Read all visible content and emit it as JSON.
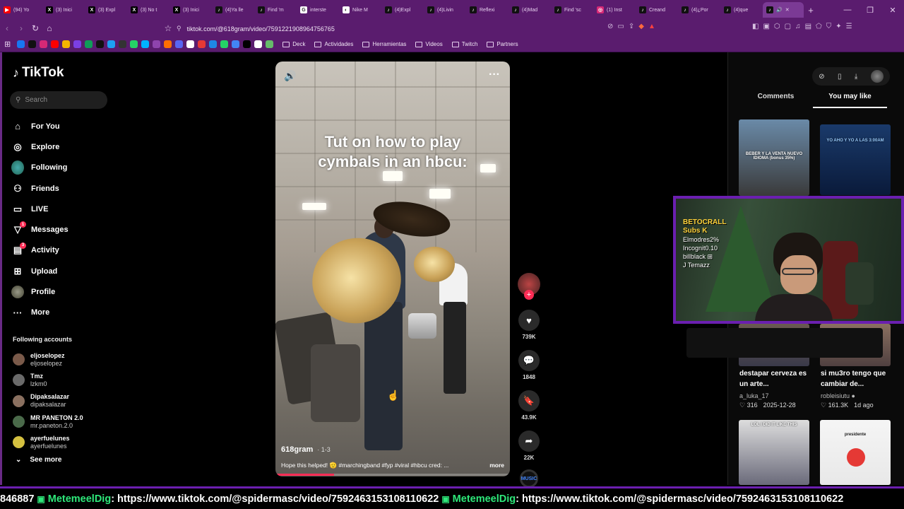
{
  "browser": {
    "tabs": [
      {
        "label": "(94) Yo",
        "icon": "youtube-icon",
        "color": "#ff0000",
        "glyph": "▶"
      },
      {
        "label": "(3) Inici",
        "icon": "x-icon",
        "color": "#000000",
        "glyph": "X"
      },
      {
        "label": "(3) Expl",
        "icon": "x-icon",
        "color": "#000000",
        "glyph": "X"
      },
      {
        "label": "(3) No t",
        "icon": "x-icon",
        "color": "#000000",
        "glyph": "X"
      },
      {
        "label": "(3) Inici",
        "icon": "x-icon",
        "color": "#000000",
        "glyph": "X"
      },
      {
        "label": "(4)Ya lle",
        "icon": "tiktok-icon",
        "color": "#111111",
        "glyph": "♪"
      },
      {
        "label": "Find 'm",
        "icon": "tiktok-icon",
        "color": "#111111",
        "glyph": "♪"
      },
      {
        "label": "interste",
        "icon": "google-icon",
        "color": "#ffffff",
        "glyph": "G"
      },
      {
        "label": "Nike M",
        "icon": "site-icon",
        "color": "#ffffff",
        "glyph": "◐"
      },
      {
        "label": "(4)Expl",
        "icon": "tiktok-icon",
        "color": "#111111",
        "glyph": "♪"
      },
      {
        "label": "(4)Livin",
        "icon": "tiktok-icon",
        "color": "#111111",
        "glyph": "♪"
      },
      {
        "label": "Reflexi",
        "icon": "tiktok-icon",
        "color": "#111111",
        "glyph": "♪"
      },
      {
        "label": "(4)Mad",
        "icon": "tiktok-icon",
        "color": "#111111",
        "glyph": "♪"
      },
      {
        "label": "Find 'sc",
        "icon": "tiktok-icon",
        "color": "#111111",
        "glyph": "♪"
      },
      {
        "label": "(1) Inst",
        "icon": "instagram-icon",
        "color": "#d62976",
        "glyph": "◎"
      },
      {
        "label": "Creand",
        "icon": "tiktok-icon",
        "color": "#111111",
        "glyph": "♪"
      },
      {
        "label": "(4)¿Por",
        "icon": "tiktok-icon",
        "color": "#111111",
        "glyph": "♪"
      },
      {
        "label": "(4)que",
        "icon": "tiktok-icon",
        "color": "#111111",
        "glyph": "♪"
      }
    ],
    "active_tab_glyph": "♪",
    "active_tab_audio": "🔊",
    "active_tab_close": "✕",
    "new_tab": "+",
    "window_controls": {
      "minimize": "—",
      "maximize": "❐",
      "close": "✕"
    },
    "url": "tiktok.com/@618gram/video/7591221908964756765",
    "bookmarks": [
      {
        "label": "Deck"
      },
      {
        "label": "Actividades"
      },
      {
        "label": "Herramientas"
      },
      {
        "label": "Videos"
      },
      {
        "label": "Twitch"
      },
      {
        "label": "Partners"
      }
    ],
    "bookmark_icon_colors": [
      "#1877f2",
      "#111111",
      "#d62976",
      "#ff0000",
      "#f4b400",
      "#7b3fe4",
      "#0f9d58",
      "#111111",
      "#1da1f2",
      "#333333",
      "#25d366",
      "#00b2ff",
      "#8e44ad",
      "#ff6f00",
      "#5865f2",
      "#ffffff",
      "#e53935",
      "#1e88e5",
      "#25d366",
      "#4285f4",
      "#000000",
      "#ffffff",
      "#66bb6a"
    ]
  },
  "tiktok": {
    "logo": "TikTok",
    "search_placeholder": "Search",
    "nav": [
      {
        "label": "For You",
        "icon": "home-icon",
        "glyph": "⌂"
      },
      {
        "label": "Explore",
        "icon": "compass-icon",
        "glyph": "◎"
      },
      {
        "label": "Following",
        "icon": "following-avatar-icon",
        "glyph": ""
      },
      {
        "label": "Friends",
        "icon": "friends-icon",
        "glyph": "⚇"
      },
      {
        "label": "LIVE",
        "icon": "live-icon",
        "glyph": "▭"
      },
      {
        "label": "Messages",
        "icon": "messages-icon",
        "glyph": "▽",
        "badge": "1"
      },
      {
        "label": "Activity",
        "icon": "activity-icon",
        "glyph": "▤",
        "badge": "3"
      },
      {
        "label": "Upload",
        "icon": "upload-icon",
        "glyph": "⊞"
      },
      {
        "label": "Profile",
        "icon": "profile-avatar-icon",
        "glyph": ""
      },
      {
        "label": "More",
        "icon": "more-icon",
        "glyph": "···"
      }
    ],
    "following_header": "Following accounts",
    "following": [
      {
        "name": "eljoselopez",
        "handle": "eljoselopez",
        "color": "#7a5a4a"
      },
      {
        "name": "Tmz",
        "handle": "lzkm0",
        "color": "#6a6a6a"
      },
      {
        "name": "Dipaksalazar",
        "handle": "dipaksalazar",
        "color": "#8a7060"
      },
      {
        "name": "MR PANETON 2.0",
        "handle": "mr.paneton.2.0",
        "color": "#4a6a4a"
      },
      {
        "name": "ayerfuelunes",
        "handle": "ayerfuelunes",
        "color": "#d4c040"
      }
    ],
    "see_more": "See more",
    "see_more_glyph": "⌄"
  },
  "video": {
    "overlay_title_line1": "Tut on how to play",
    "overlay_title_line2": "cymbals in an hbcu:",
    "volume_glyph": "🔊",
    "more_glyph": "···",
    "author": "618gram",
    "date": "1-3",
    "caption": "Hope this helped! 🫡 #marchingband #fyp #viral #hbcu cred: ...",
    "more_label": "more",
    "progress": 0.25,
    "cursor_glyph": "☝"
  },
  "actions": {
    "follow_plus": "+",
    "likes": "739K",
    "comments": "1848",
    "saves": "43.9K",
    "shares": "22K",
    "like_glyph": "♥",
    "comment_glyph": "💬",
    "save_glyph": "🔖",
    "share_glyph": "➦",
    "music_label": "MUSIC"
  },
  "right_panel": {
    "tool_glyphs": [
      "⊘",
      "▯",
      "⤓"
    ],
    "tabs": [
      {
        "label": "Comments",
        "active": false
      },
      {
        "label": "You may like",
        "active": true
      }
    ],
    "thumb1_text": "BEBER Y LA VENTA NUEVO IDIOMA (bonus 35%)",
    "thumb2_text": "YO AHO Y YO A LAS 3:00AM",
    "cards": [
      {
        "title": "destapar cerveza es un arte...",
        "user": "a_luka_17",
        "likes": "♡ 316",
        "date": "2025-12-28"
      },
      {
        "title": "si mu3ro tengo que cambiar de...",
        "user": "robleisiutu ●",
        "likes": "♡ 161.3K",
        "date": "1d ago"
      }
    ],
    "thumb5_text": "LOL I DID IT LIKE THIS",
    "thumb6_text": "presidente"
  },
  "webcam": {
    "lines": [
      "BETOCRALL",
      "Subs K",
      "Elmodres2%",
      "Incognit0.10",
      "billblack ⊞",
      "J Temazz"
    ]
  },
  "ticker": {
    "lead": "846887",
    "user": "MetemeelDig",
    "link": ": https://www.tiktok.com/@spidermasc/video/7592463153108110622"
  }
}
